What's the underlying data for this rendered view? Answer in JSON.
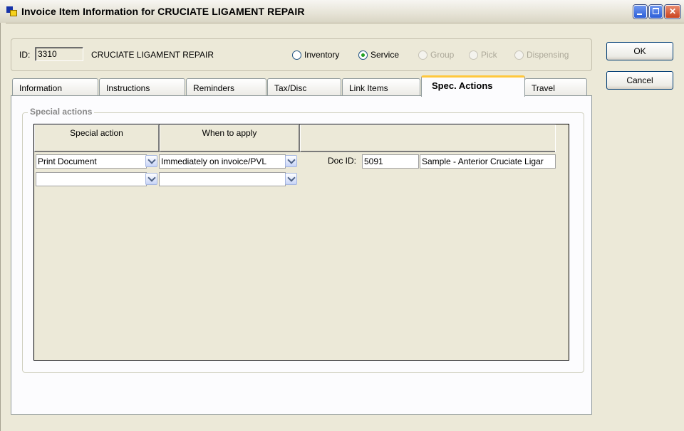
{
  "window": {
    "title": "Invoice Item Information for CRUCIATE LIGAMENT REPAIR",
    "controls": [
      "minimize-icon",
      "maximize-icon",
      "close-icon"
    ]
  },
  "header": {
    "id_label": "ID:",
    "id_value": "3310",
    "item_name": "CRUCIATE LIGAMENT REPAIR",
    "item_types": [
      {
        "label": "Inventory",
        "checked": false,
        "enabled": true
      },
      {
        "label": "Service",
        "checked": true,
        "enabled": true
      },
      {
        "label": "Group",
        "checked": false,
        "enabled": false
      },
      {
        "label": "Pick",
        "checked": false,
        "enabled": false
      },
      {
        "label": "Dispensing",
        "checked": false,
        "enabled": false
      }
    ]
  },
  "buttons": {
    "ok": "OK",
    "cancel": "Cancel"
  },
  "tabs": [
    {
      "label": "Information"
    },
    {
      "label": "Instructions"
    },
    {
      "label": "Reminders"
    },
    {
      "label": "Tax/Disc"
    },
    {
      "label": "Link Items"
    },
    {
      "label": "Spec. Actions",
      "active": true
    },
    {
      "label": "Travel"
    }
  ],
  "special_actions": {
    "group_title": "Special actions",
    "columns": [
      "Special action",
      "When to apply",
      ""
    ],
    "rows": [
      {
        "action": "Print Document",
        "when": "Immediately on invoice/PVL",
        "doc_id_label": "Doc ID:",
        "doc_id": "5091",
        "doc_name": "Sample - Anterior Cruciate Ligar"
      },
      {
        "action": "",
        "when": "",
        "doc_id_label": "",
        "doc_id": "",
        "doc_name": ""
      }
    ]
  },
  "colors": {
    "window_bg": "#ece9d8",
    "panel_bg": "#fcfcfe",
    "active_tab_accent": "#ffc83c",
    "titlebar_button_blue": "#2d5fd8",
    "close_button_red": "#c9431f"
  }
}
